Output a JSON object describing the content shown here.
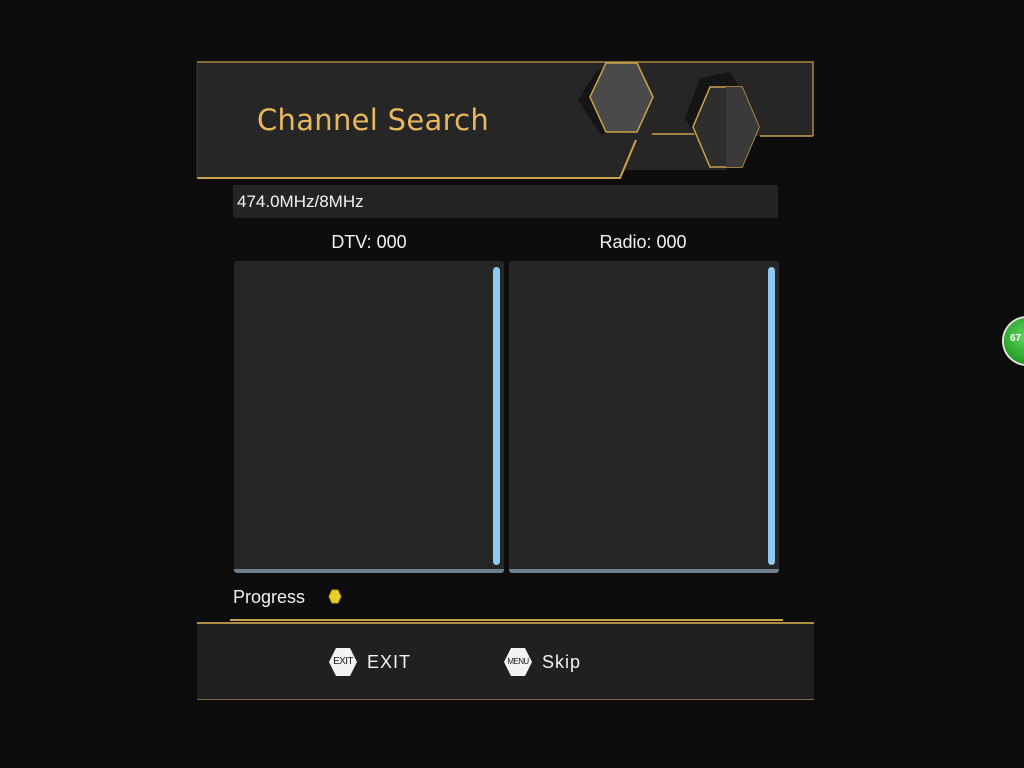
{
  "header": {
    "title": "Channel Search"
  },
  "frequency": {
    "value": "474.0MHz/8MHz"
  },
  "counts": {
    "dtv_label": "DTV: 000",
    "radio_label": "Radio: 000"
  },
  "lists": {
    "dtv_items": [],
    "radio_items": []
  },
  "progress": {
    "label": "Progress",
    "percent": 0
  },
  "footer": {
    "exit_badge": "EXIT",
    "exit_label": "EXIT",
    "menu_badge": "MENU",
    "skip_label": "Skip"
  },
  "side_indicator": {
    "text": "67"
  },
  "colors": {
    "accent_gold": "#c9a24e",
    "title_gold": "#e8b85e",
    "scrollbar_blue": "#8fc8f0",
    "progress_yellow": "#e8cf2a",
    "indicator_green": "#2da52d"
  }
}
